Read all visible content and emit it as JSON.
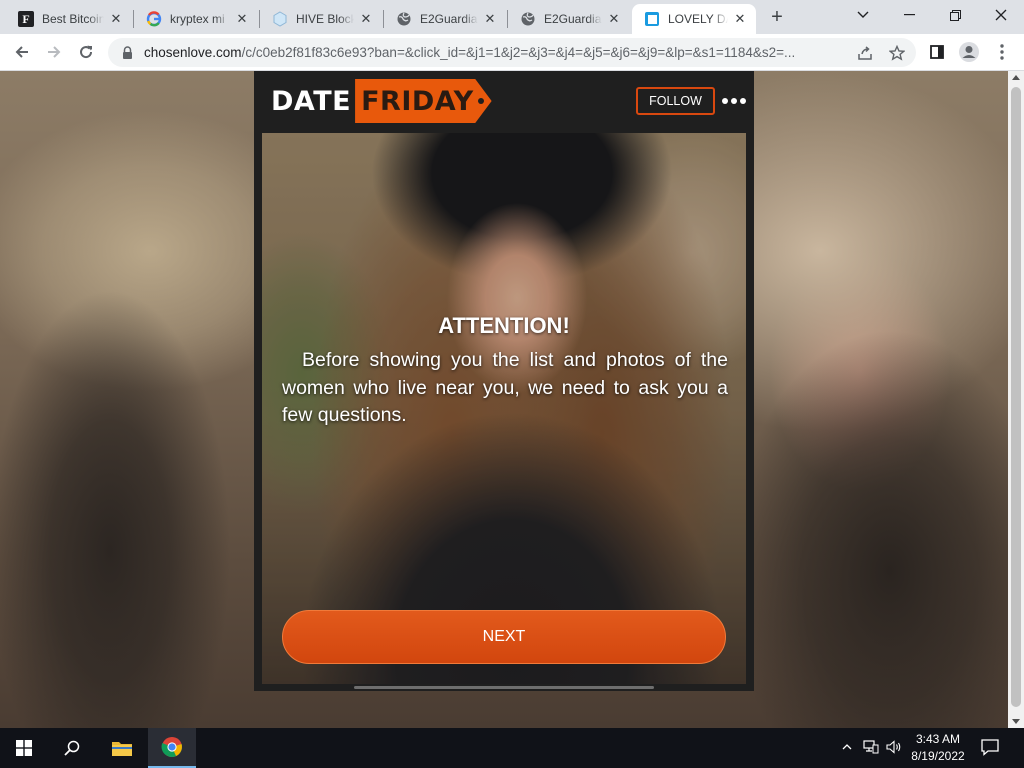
{
  "browser": {
    "tabs": [
      {
        "title": "Best Bitcoin",
        "favicon": "letter-f-icon",
        "active": false
      },
      {
        "title": "kryptex mi",
        "favicon": "google-icon",
        "active": false
      },
      {
        "title": "HIVE Block",
        "favicon": "hive-icon",
        "active": false
      },
      {
        "title": "E2Guardian",
        "favicon": "globe-icon",
        "active": false
      },
      {
        "title": "E2Guardian",
        "favicon": "globe-icon",
        "active": false
      },
      {
        "title": "LOVELY DA",
        "favicon": "lovely-icon",
        "active": true
      }
    ],
    "url": {
      "host": "chosenlove.com",
      "rest": "/c/c0eb2f81f83c6e93?ban=&click_id=&j1=1&j2=&j3=&j4=&j5=&j6=&j9=&lp=&s1=1184&s2=..."
    }
  },
  "page": {
    "logo": {
      "part1": "DATE",
      "part2": "FRIDAY"
    },
    "follow_label": "FOLLOW",
    "heading": "ATTENTION!",
    "message": "Before showing you the list and photos of the women who live near you, we need to ask you a few questions.",
    "next_label": "NEXT",
    "colors": {
      "accent": "#d9480f",
      "panel": "#1f1f1f"
    }
  },
  "taskbar": {
    "time": "3:43 AM",
    "date": "8/19/2022"
  }
}
